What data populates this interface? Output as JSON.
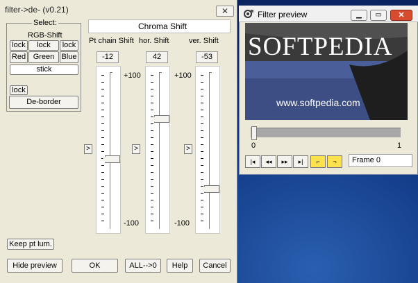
{
  "dialog": {
    "title": "filter->de- (v0.21)",
    "close_label": "✕",
    "select_label": "Select:",
    "rgb_shift_label": "RGB-Shift",
    "lock_label": "lock",
    "channels": [
      "Red",
      "Green",
      "Blue"
    ],
    "stick_label": "stick",
    "deborder_label": "De-border",
    "chroma_header": "Chroma Shift",
    "sliders": [
      {
        "label": "Pt chain Shift",
        "value": "-12",
        "level": 0.44
      },
      {
        "label": "hor. Shift",
        "value": "42",
        "level": 0.71
      },
      {
        "label": "ver. Shift",
        "value": "-53",
        "level": 0.24
      }
    ],
    "scale_max": "+100",
    "scale_min": "-100",
    "arrow_label": ">",
    "keep_label": "Keep pt lum.",
    "buttons": {
      "hide_preview": "Hide preview",
      "ok": "OK",
      "all0": "ALL-->0",
      "help": "Help",
      "cancel": "Cancel"
    }
  },
  "preview": {
    "title": "Filter preview",
    "logo_text": "SOFTPEDIA",
    "url_text": "www.softpedia.com",
    "watermark": "SOFTPEDIA",
    "timeline_start": "0",
    "timeline_end": "1",
    "frame_label": "Frame 0",
    "nav_icons": [
      "go-start-icon",
      "step-back-icon",
      "step-forward-icon",
      "go-end-icon",
      "mark-in-icon",
      "mark-out-icon"
    ]
  }
}
